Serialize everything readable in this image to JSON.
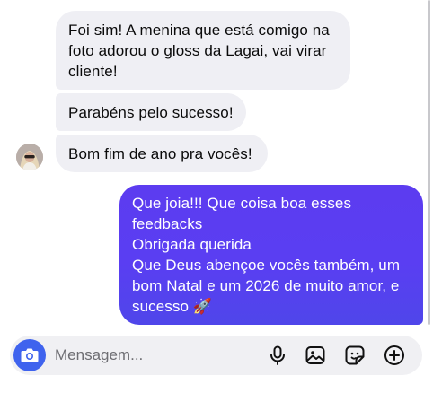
{
  "thread": {
    "incoming": [
      {
        "lines": [
          "Foi sim! A menina que está comigo na",
          "foto adorou o gloss da Lagai, vai virar",
          "cliente!"
        ]
      },
      {
        "lines": [
          "Parabéns pelo sucesso!"
        ]
      },
      {
        "lines": [
          "Bom fim de ano pra vocês!"
        ]
      }
    ],
    "outgoing": {
      "lines": [
        "Que joia!!! Que coisa boa esses",
        "feedbacks",
        "Obrigada querida",
        "Que Deus abençoe vocês também, um",
        "bom Natal e um 2026 de muito amor, e",
        "sucesso 🚀"
      ]
    }
  },
  "composer": {
    "placeholder": "Mensagem...",
    "value": ""
  },
  "icons": {
    "camera": "camera-icon",
    "mic": "microphone-icon",
    "gallery": "gallery-icon",
    "sticker": "sticker-icon",
    "plus": "add-icon"
  },
  "colors": {
    "incoming_bubble": "#efeff4",
    "outgoing_bubble": "#5a3ef2",
    "camera_button": "#3f63ee",
    "composer_bg": "#f0f0f3"
  }
}
